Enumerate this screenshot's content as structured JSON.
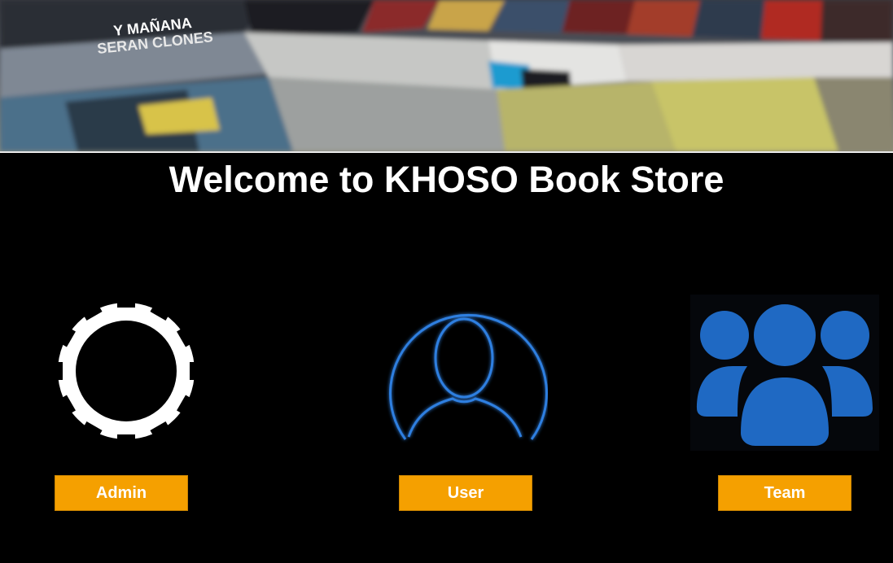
{
  "banner": {
    "image_description": "blurred bookshelf photo",
    "visible_spine_text": [
      "Y MAÑANA",
      "SERAN CLONES"
    ]
  },
  "page": {
    "title": "Welcome to KHOSO Book Store"
  },
  "roles": [
    {
      "label": "Admin",
      "icon": "gear-icon"
    },
    {
      "label": "User",
      "icon": "user-icon"
    },
    {
      "label": "Team",
      "icon": "team-icon"
    }
  ],
  "colors": {
    "background": "#000000",
    "button": "#f5a000",
    "button_text": "#ffffff",
    "user_outline": "#2f7fe0",
    "team_fill": "#1f69c3"
  }
}
